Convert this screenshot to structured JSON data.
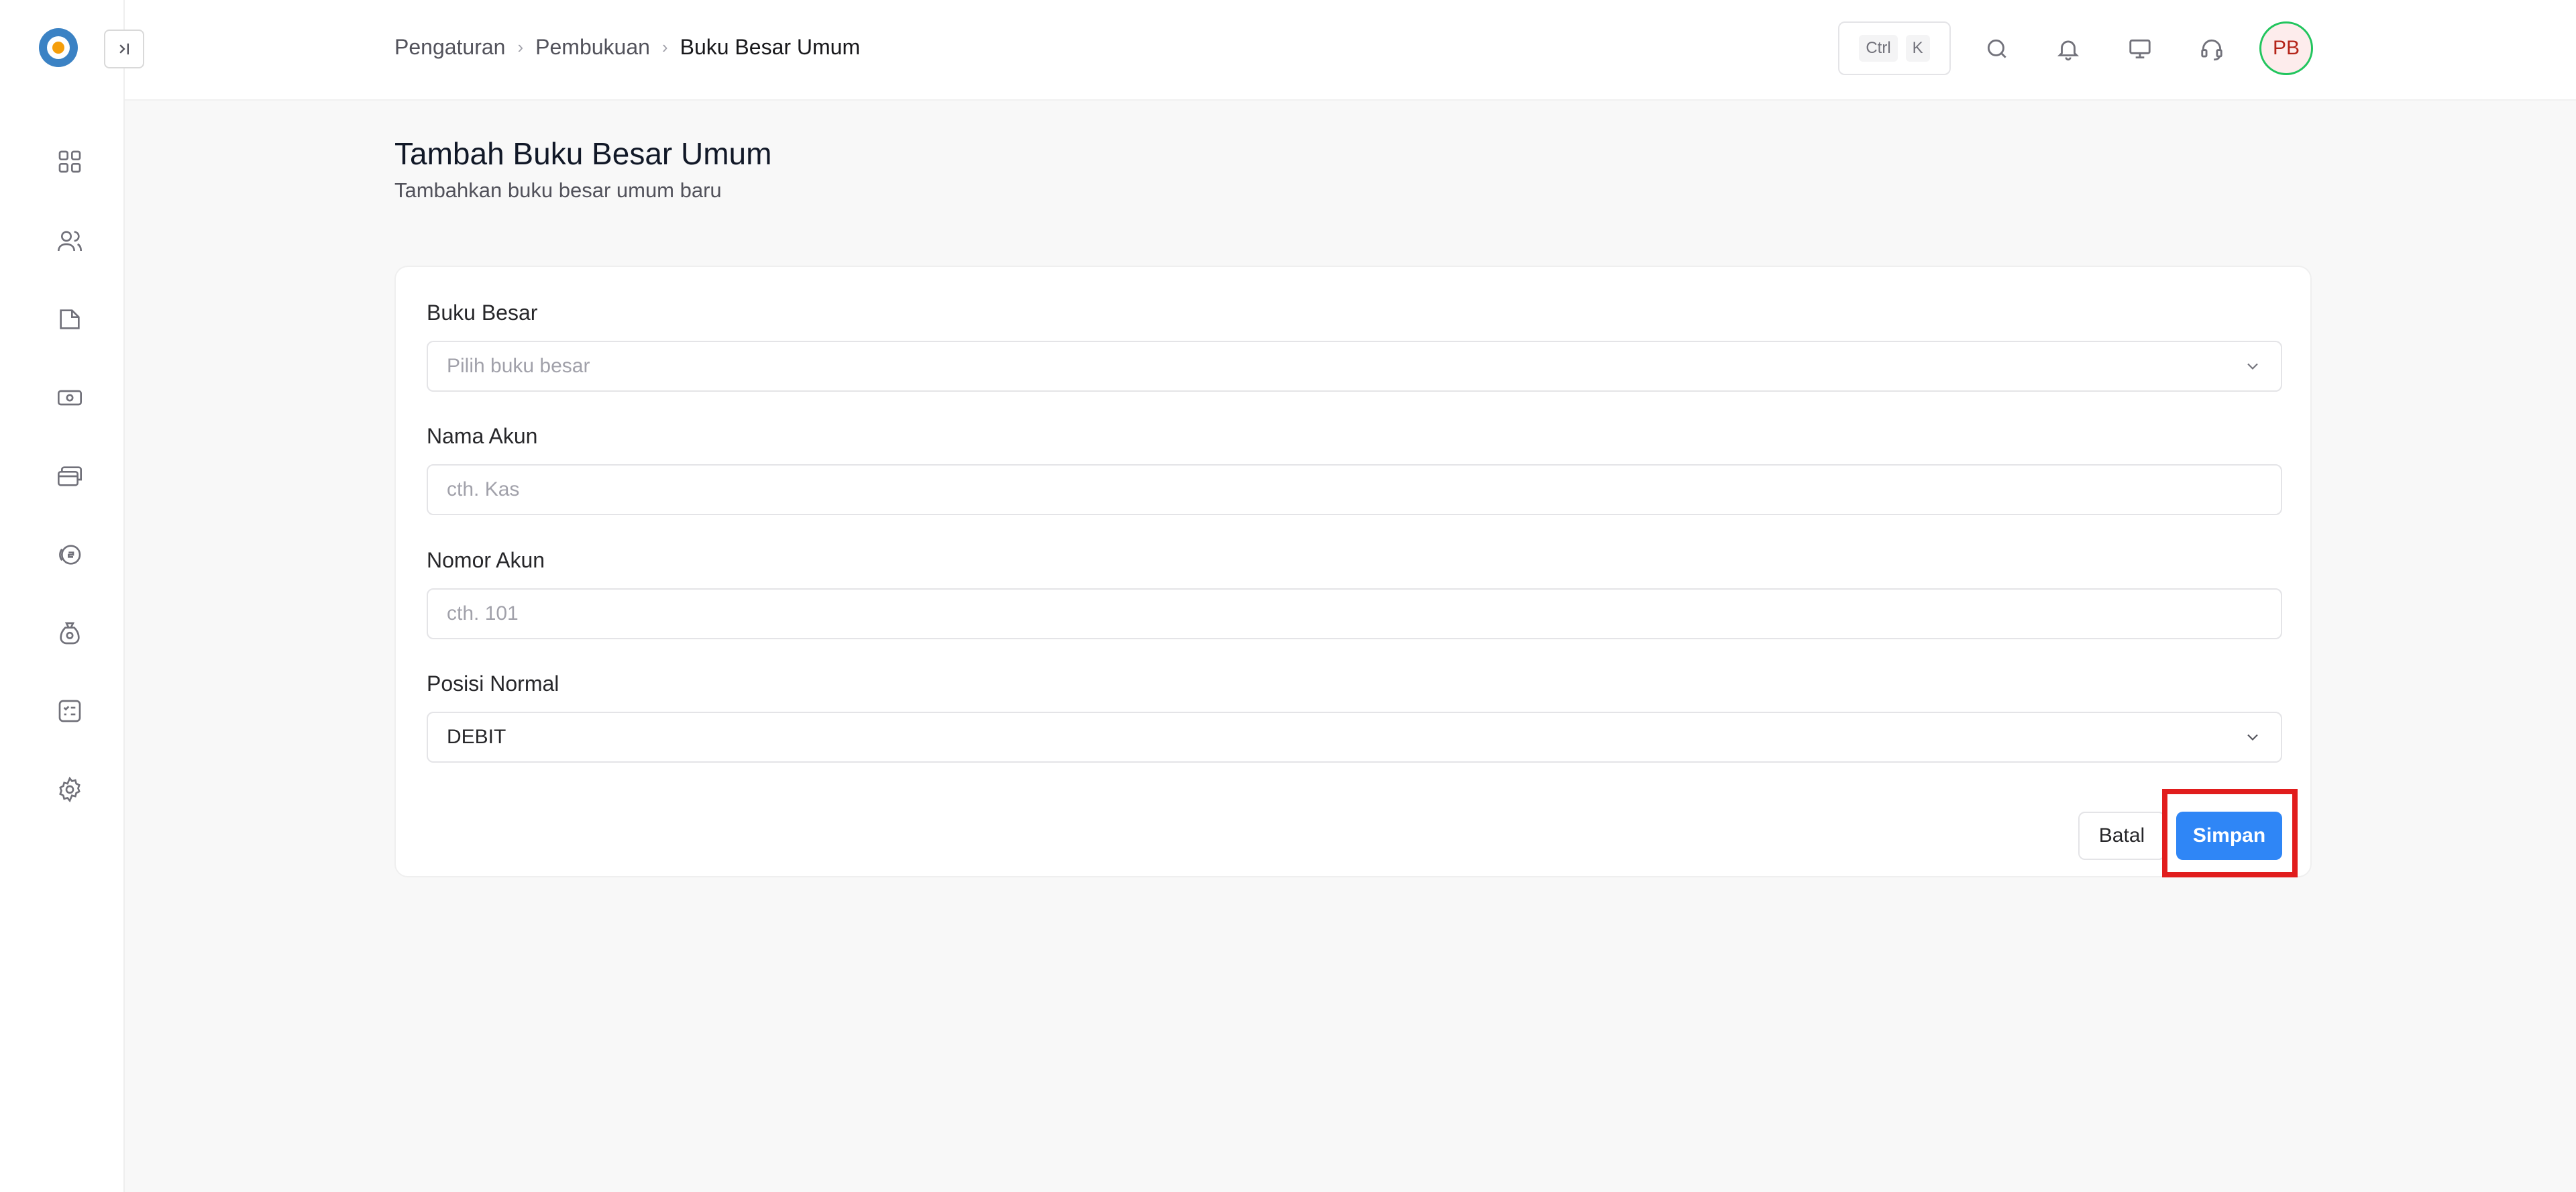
{
  "colors": {
    "primary": "#2f86f6",
    "highlight": "#e11d1d",
    "avatar_ring": "#22c55e",
    "background": "#f8f8f8"
  },
  "sidebar": {
    "logo": "tut-wuri-handayani-logo",
    "collapse_icon": "panel-expand-icon",
    "items": [
      {
        "icon": "dashboard-grid-icon"
      },
      {
        "icon": "users-icon"
      },
      {
        "icon": "folder-icon"
      },
      {
        "icon": "cash-icon"
      },
      {
        "icon": "cards-icon"
      },
      {
        "icon": "coin-icon"
      },
      {
        "icon": "money-bag-icon"
      },
      {
        "icon": "checklist-icon"
      },
      {
        "icon": "gear-icon"
      }
    ]
  },
  "header": {
    "breadcrumb": [
      "Pengaturan",
      "Pembukuan",
      "Buku Besar Umum"
    ],
    "shortcut": {
      "key1": "Ctrl",
      "key2": "K"
    },
    "icons": [
      "search-icon",
      "bell-icon",
      "monitor-icon",
      "headset-icon"
    ],
    "avatar_initials": "PB"
  },
  "page": {
    "title": "Tambah Buku Besar Umum",
    "subtitle": "Tambahkan buku besar umum baru"
  },
  "form": {
    "ledger": {
      "label": "Buku Besar",
      "placeholder": "Pilih buku besar"
    },
    "account_name": {
      "label": "Nama Akun",
      "placeholder": "cth. Kas"
    },
    "account_number": {
      "label": "Nomor Akun",
      "placeholder": "cth. 101"
    },
    "normal_position": {
      "label": "Posisi Normal",
      "value": "DEBIT"
    },
    "cancel_label": "Batal",
    "save_label": "Simpan"
  }
}
